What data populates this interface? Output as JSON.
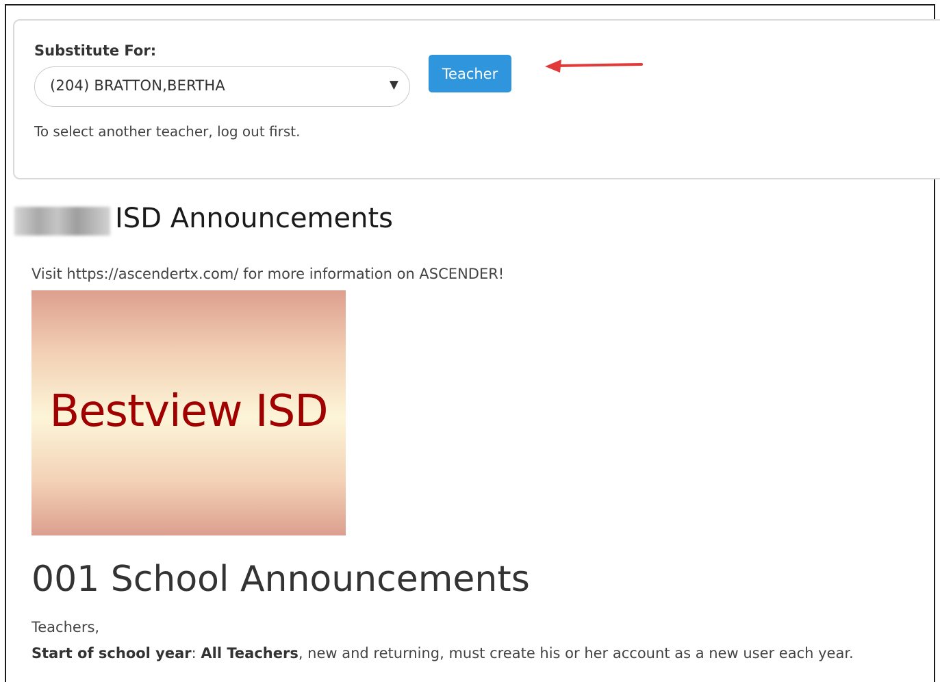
{
  "substitute": {
    "label": "Substitute For:",
    "selected_value": "(204) BRATTON,BERTHA",
    "caret": "▼",
    "hint": "To select another teacher, log out first."
  },
  "teacher_button": {
    "label": "Teacher"
  },
  "announcements": {
    "title": "ISD Announcements",
    "visit_text": "Visit https://ascendertx.com/ for more information on ASCENDER!",
    "banner_text": "Bestview ISD"
  },
  "school": {
    "title": "001 School Announcements",
    "greeting": "Teachers,",
    "start_label": "Start of school year",
    "colon": ": ",
    "all_teachers": "All Teachers",
    "rest": ", new and returning, must create his or her account as a new user each year."
  },
  "colors": {
    "button_blue": "#2f95dc",
    "arrow_red": "#e03a3a",
    "banner_text": "#a00000"
  },
  "icons": {
    "select_caret": "triangle-down",
    "annotation": "red-arrow-left"
  }
}
